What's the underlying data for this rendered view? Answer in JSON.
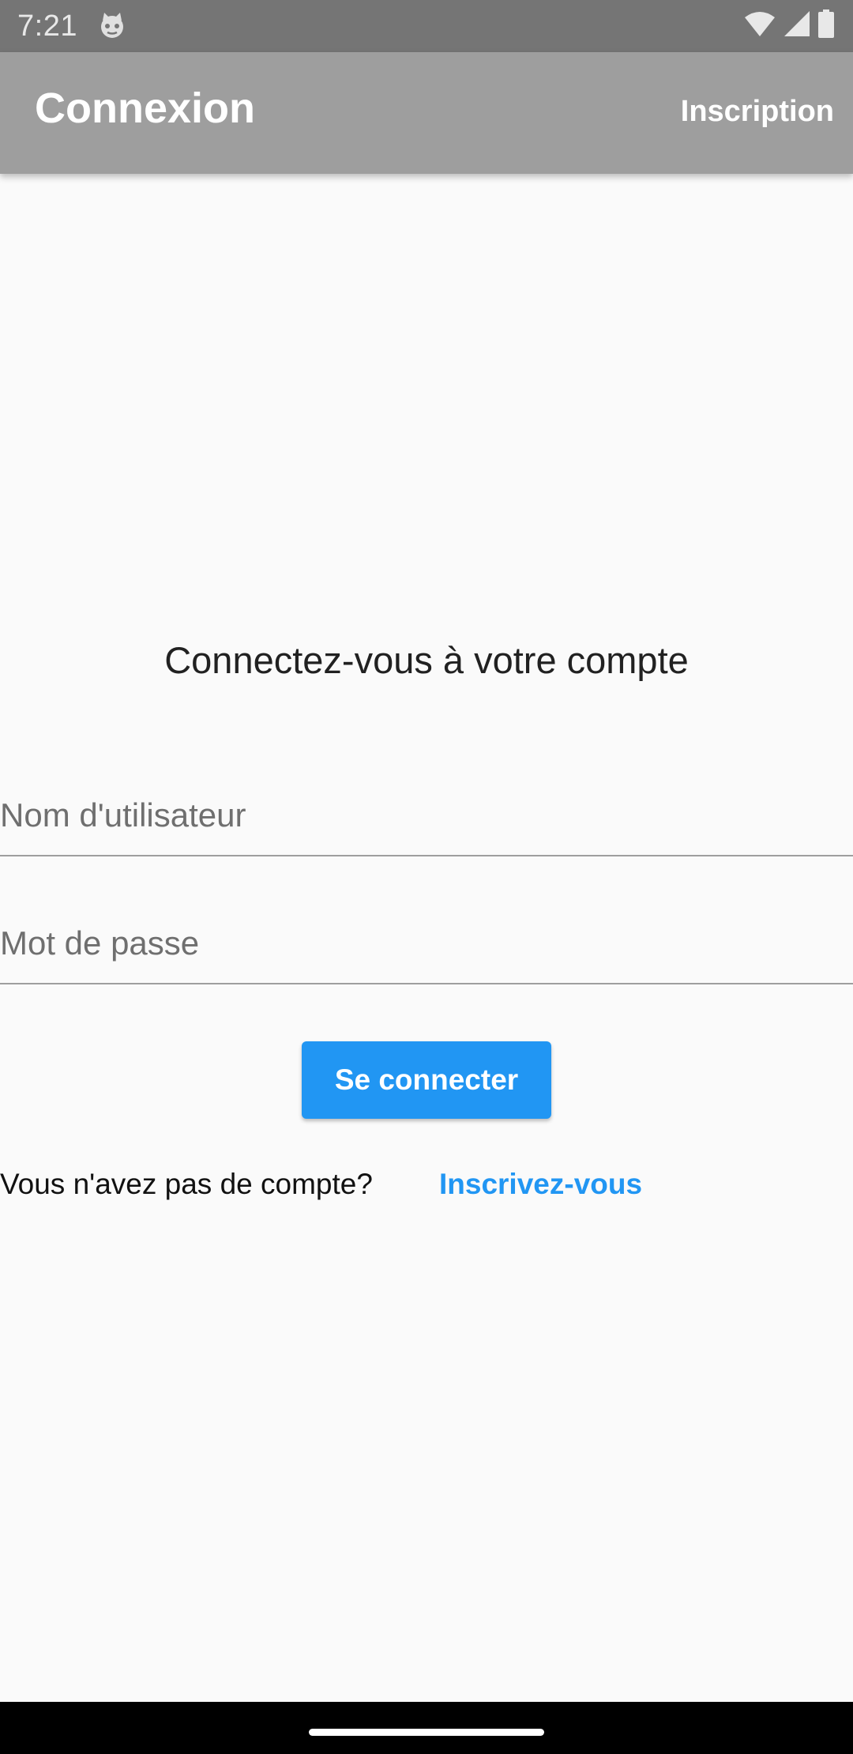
{
  "status_bar": {
    "time": "7:21",
    "icons": [
      "cat-face-icon",
      "wifi-icon",
      "cellular-signal-icon",
      "battery-icon"
    ]
  },
  "app_bar": {
    "title": "Connexion",
    "action_label": "Inscription"
  },
  "login_form": {
    "heading": "Connectez-vous à votre compte",
    "username": {
      "value": "",
      "placeholder": "Nom d'utilisateur"
    },
    "password": {
      "value": "",
      "placeholder": "Mot de passe"
    },
    "submit_label": "Se connecter",
    "signup_prompt": "Vous n'avez pas de compte?",
    "signup_link": "Inscrivez-vous"
  },
  "colors": {
    "status_bar": "#757575",
    "app_bar": "#9e9e9e",
    "background": "#fafafa",
    "accent": "#2196f3"
  }
}
